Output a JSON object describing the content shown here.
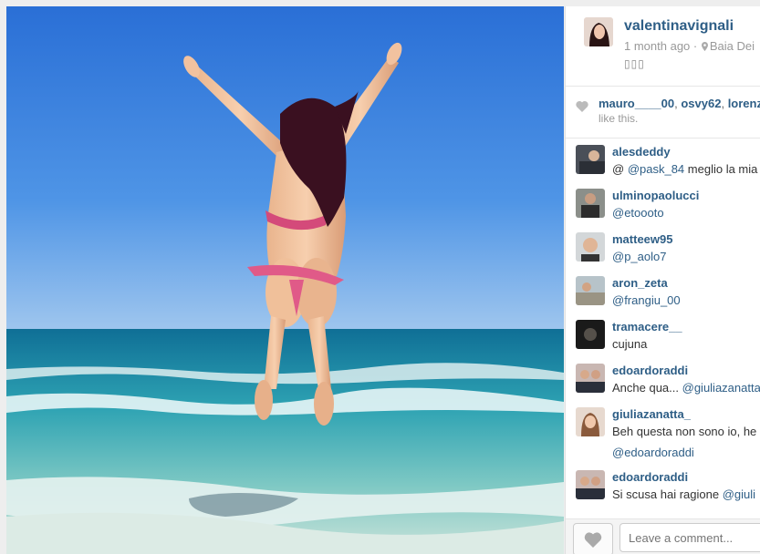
{
  "post": {
    "username": "valentinavignali",
    "time_ago": "1 month ago",
    "separator": "·",
    "location": "Baia Dei",
    "caption": "▯▯▯",
    "icons": {
      "location": "map-pin-icon",
      "like": "heart-icon"
    }
  },
  "likes": {
    "users": [
      "mauro____00",
      "osvy62",
      "lorenz"
    ],
    "suffix": "like this."
  },
  "comments": [
    {
      "user": "alesdeddy",
      "mention": "@pask_84",
      "text_before": "@ ",
      "text_after": " meglio la mia"
    },
    {
      "user": "ulminopaolucci",
      "mention": "@etoooto",
      "text_before": "",
      "text_after": ""
    },
    {
      "user": "matteew95",
      "mention": "@p_aolo7",
      "text_before": "",
      "text_after": ""
    },
    {
      "user": "aron_zeta",
      "mention": "@frangiu_00",
      "text_before": "",
      "text_after": ""
    },
    {
      "user": "tramacere__",
      "mention": "",
      "text_before": "cujuna",
      "text_after": ""
    },
    {
      "user": "edoardoraddi",
      "mention": "@giuliazanatta",
      "text_before": "Anche qua... ",
      "text_after": ""
    },
    {
      "user": "giuliazanatta_",
      "mention": "@edoardoraddi",
      "text_before": "Beh questa non sono io, he",
      "text_after": ""
    },
    {
      "user": "edoardoraddi",
      "mention": "@giuli",
      "text_before": "Si scusa hai ragione ",
      "text_after": ""
    }
  ],
  "footer": {
    "comment_placeholder": "Leave a comment..."
  }
}
